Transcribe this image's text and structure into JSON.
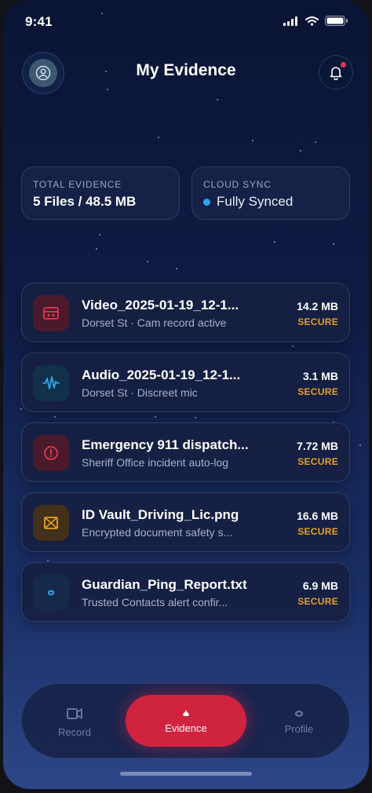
{
  "status_bar": {
    "time": "9:41"
  },
  "header": {
    "title": "My Evidence"
  },
  "stats": {
    "total_label": "TOTAL EVIDENCE",
    "total_value": "5 Files / 48.5 MB",
    "sync_label": "CLOUD SYNC",
    "sync_value": "Fully Synced"
  },
  "files": [
    {
      "name": "Video_2025-01-19_12-1...",
      "desc": "Dorset St · Cam record active",
      "size": "14.2 MB",
      "status": "SECURE",
      "icon": "video-cassette-icon",
      "color": "#e0384f"
    },
    {
      "name": "Audio_2025-01-19_12-1...",
      "desc": "Dorset St · Discreet mic",
      "size": "3.1 MB",
      "status": "SECURE",
      "icon": "audio-wave-icon",
      "color": "#29a8e8"
    },
    {
      "name": "Emergency 911 dispatch...",
      "desc": "Sheriff Office incident auto-log",
      "size": "7.72 MB",
      "status": "SECURE",
      "icon": "alert-circle-icon",
      "color": "#e0384f"
    },
    {
      "name": "ID Vault_Driving_Lic.png",
      "desc": "Encrypted document safety s...",
      "size": "16.6 MB",
      "status": "SECURE",
      "icon": "id-card-icon",
      "color": "#e6a11f"
    },
    {
      "name": "Guardian_Ping_Report.txt",
      "desc": "Trusted Contacts alert confir...",
      "size": "6.9 MB",
      "status": "SECURE",
      "icon": "ping-icon",
      "color": "#29a8e8"
    }
  ],
  "tabs": {
    "record": "Record",
    "evidence": "Evidence",
    "profile": "Profile"
  }
}
